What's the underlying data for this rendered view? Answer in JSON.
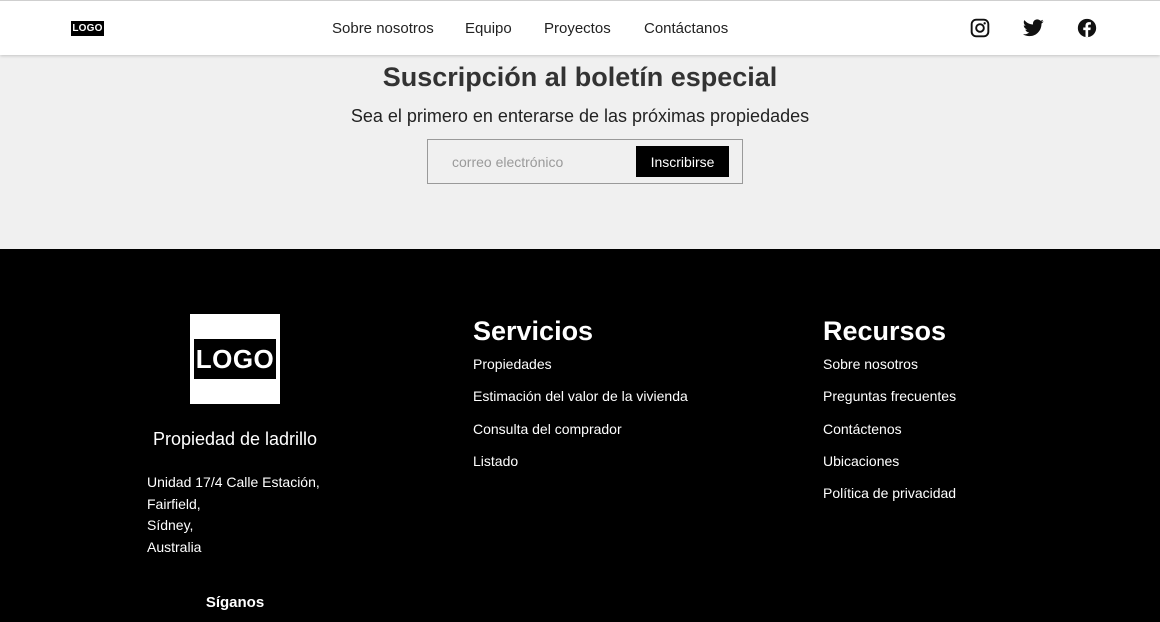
{
  "nav": {
    "logo": "LOGO",
    "links": [
      "Sobre nosotros",
      "Equipo",
      "Proyectos",
      "Contáctanos"
    ],
    "social_icons": [
      "instagram-icon",
      "twitter-icon",
      "facebook-icon"
    ]
  },
  "newsletter": {
    "title": "Suscripción al boletín especial",
    "subtitle": "Sea el primero en enterarse de las próximas propiedades",
    "email_placeholder": "correo electrónico",
    "email_value": "",
    "button_label": "Inscribirse"
  },
  "footer": {
    "logo": "LOGO",
    "company": "Propiedad de ladrillo",
    "address": [
      "Unidad 17/4 Calle Estación,",
      "Fairfield,",
      "Sídney,",
      "Australia"
    ],
    "follow_label": "Síganos",
    "services": {
      "title": "Servicios",
      "links": [
        "Propiedades",
        "Estimación del valor de la vivienda",
        "Consulta del comprador",
        "Listado"
      ]
    },
    "resources": {
      "title": "Recursos",
      "links": [
        "Sobre nosotros",
        "Preguntas frecuentes",
        "Contáctenos",
        "Ubicaciones",
        "Política de privacidad"
      ]
    }
  },
  "colors": {
    "nav_bg": "#ffffff",
    "newsletter_bg": "#f0f0f0",
    "footer_bg": "#000000",
    "button_bg": "#000000",
    "text_light": "#ffffff"
  }
}
